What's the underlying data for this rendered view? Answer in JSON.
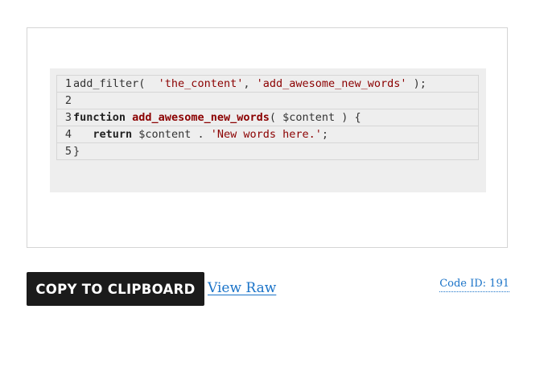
{
  "snippet": {
    "lines": [
      {
        "number": "1",
        "tokens": [
          {
            "type": "plain",
            "text": "add_filter(  "
          },
          {
            "type": "str",
            "text": "'the_content'"
          },
          {
            "type": "plain",
            "text": ", "
          },
          {
            "type": "str",
            "text": "'add_awesome_new_words'"
          },
          {
            "type": "plain",
            "text": " );"
          }
        ]
      },
      {
        "number": "2",
        "tokens": []
      },
      {
        "number": "3",
        "tokens": [
          {
            "type": "kw",
            "text": "function"
          },
          {
            "type": "plain",
            "text": " "
          },
          {
            "type": "fn",
            "text": "add_awesome_new_words"
          },
          {
            "type": "plain",
            "text": "( $content ) {"
          }
        ]
      },
      {
        "number": "4",
        "tokens": [
          {
            "type": "plain",
            "text": "   "
          },
          {
            "type": "kw",
            "text": "return"
          },
          {
            "type": "plain",
            "text": " $content . "
          },
          {
            "type": "str",
            "text": "'New words here.'"
          },
          {
            "type": "plain",
            "text": ";"
          }
        ]
      },
      {
        "number": "5",
        "tokens": [
          {
            "type": "plain",
            "text": "}"
          }
        ]
      }
    ]
  },
  "actions": {
    "copy_label": "COPY TO CLIPBOARD",
    "view_raw_label": "View Raw",
    "code_id_label": "Code ID: 191"
  }
}
